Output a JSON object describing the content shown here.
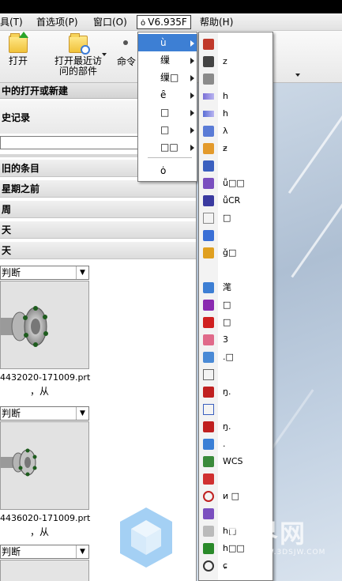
{
  "menubar": {
    "items": [
      "具(T)",
      "首选项(P)",
      "窗口(O)",
      "V6.935F",
      "帮助(H)"
    ],
    "active_index": 3
  },
  "ribbon": {
    "open_label": "打开",
    "recent_label_1": "打开最近访",
    "recent_label_2": "问的部件",
    "command_label": "命令"
  },
  "panel": {
    "title": "中的打开或新建",
    "history_title": "史记录",
    "search_value": "",
    "groups": [
      "旧的条目",
      "星期之前",
      "周",
      "天",
      "天"
    ],
    "entries": [
      {
        "filter": "判断",
        "filename": "4432020-171009.prt",
        "from": "，从"
      },
      {
        "filter": "判断",
        "filename": "4436020-171009.prt",
        "from": "，从"
      },
      {
        "filter": "判断"
      }
    ]
  },
  "menu1": {
    "items": [
      {
        "label": "ù",
        "submenu": true,
        "highlighted": true
      },
      {
        "label": "缫",
        "submenu": true
      },
      {
        "label": "缫□",
        "submenu": true
      },
      {
        "label": "ȇ",
        "submenu": true
      },
      {
        "label": "□",
        "submenu": true
      },
      {
        "label": "□",
        "submenu": true
      },
      {
        "label": "□□",
        "submenu": true
      },
      {
        "label": "ȯ",
        "submenu": false
      }
    ]
  },
  "menu2": {
    "items": [
      {
        "icon": "feature-icon",
        "label": ""
      },
      {
        "icon": "cross-icon",
        "label": "z"
      },
      {
        "icon": "sheet-icon",
        "label": ""
      },
      {
        "icon": "arrow-left-icon",
        "label": "h"
      },
      {
        "icon": "arrow-right-icon",
        "label": "h"
      },
      {
        "icon": "pencil-icon",
        "label": "λ"
      },
      {
        "icon": "blocks-icon",
        "label": "ƶ"
      },
      {
        "icon": "stamp-icon",
        "label": ""
      },
      {
        "icon": "toolbox-icon",
        "label": "ǚ□□"
      },
      {
        "icon": "hook-icon",
        "label": "ǚCR"
      },
      {
        "icon": "cube-outline-icon",
        "label": "□"
      },
      {
        "icon": "bucket-icon",
        "label": ""
      },
      {
        "icon": "layer-icon",
        "label": "ǧ□"
      },
      {
        "icon": "",
        "label": ""
      },
      {
        "icon": "cube-blue-icon",
        "label": "滗"
      },
      {
        "icon": "cube-purple-icon",
        "label": "□"
      },
      {
        "icon": "cube-red-icon",
        "label": "□"
      },
      {
        "icon": "drop-icon",
        "label": "3"
      },
      {
        "icon": "fold-icon",
        "label": ".□"
      },
      {
        "icon": "rect-icon",
        "label": ""
      },
      {
        "icon": "section-icon",
        "label": "ŋ."
      },
      {
        "icon": "hexagon-icon",
        "label": ""
      },
      {
        "icon": "gear-red-icon",
        "label": "ŋ."
      },
      {
        "icon": "pipe-icon",
        "label": "."
      },
      {
        "icon": "axes-icon",
        "label": "WCS"
      },
      {
        "icon": "grid-red-icon",
        "label": ""
      },
      {
        "icon": "circle-red-icon",
        "label": "и □"
      },
      {
        "icon": "pen-icon",
        "label": ""
      },
      {
        "icon": "cube-white-icon",
        "label": "h□"
      },
      {
        "icon": "play-icon",
        "label": "h□□"
      },
      {
        "icon": "ring-icon",
        "label": "ɕ"
      }
    ]
  },
  "watermark": {
    "text": "世界网",
    "url": "WWW.3DSJW.COM"
  },
  "colors": {
    "highlight": "#3d7fd4",
    "menu_bg": "#ffffff",
    "panel_header": "#d3d3d3"
  }
}
